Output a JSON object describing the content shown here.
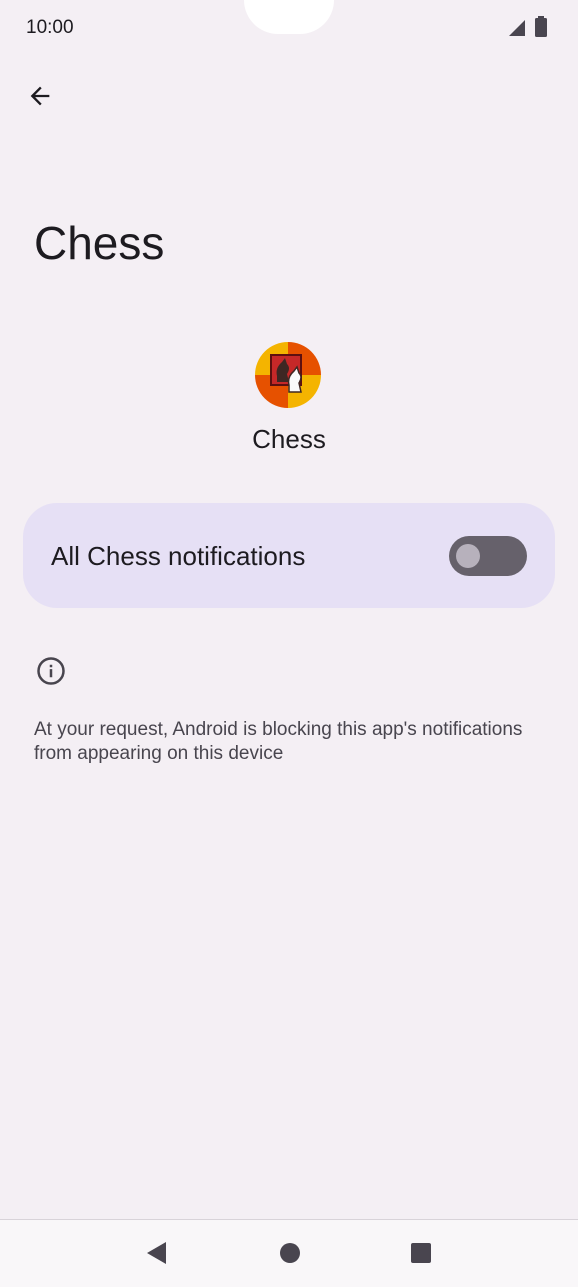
{
  "status_bar": {
    "time": "10:00"
  },
  "header": {
    "title": "Chess"
  },
  "app": {
    "name": "Chess"
  },
  "notifications_toggle": {
    "label": "All Chess notifications",
    "enabled": false
  },
  "info": {
    "text": "At your request, Android is blocking this app's notifications from appearing on this device"
  },
  "colors": {
    "background": "#f4eff4",
    "card": "#e6e0f5",
    "switch_off_track": "#66616b"
  },
  "icons": [
    "signal-icon",
    "battery-icon",
    "back-arrow-icon",
    "chess-app-icon",
    "info-icon",
    "back-nav-icon",
    "home-nav-icon",
    "recents-nav-icon"
  ]
}
